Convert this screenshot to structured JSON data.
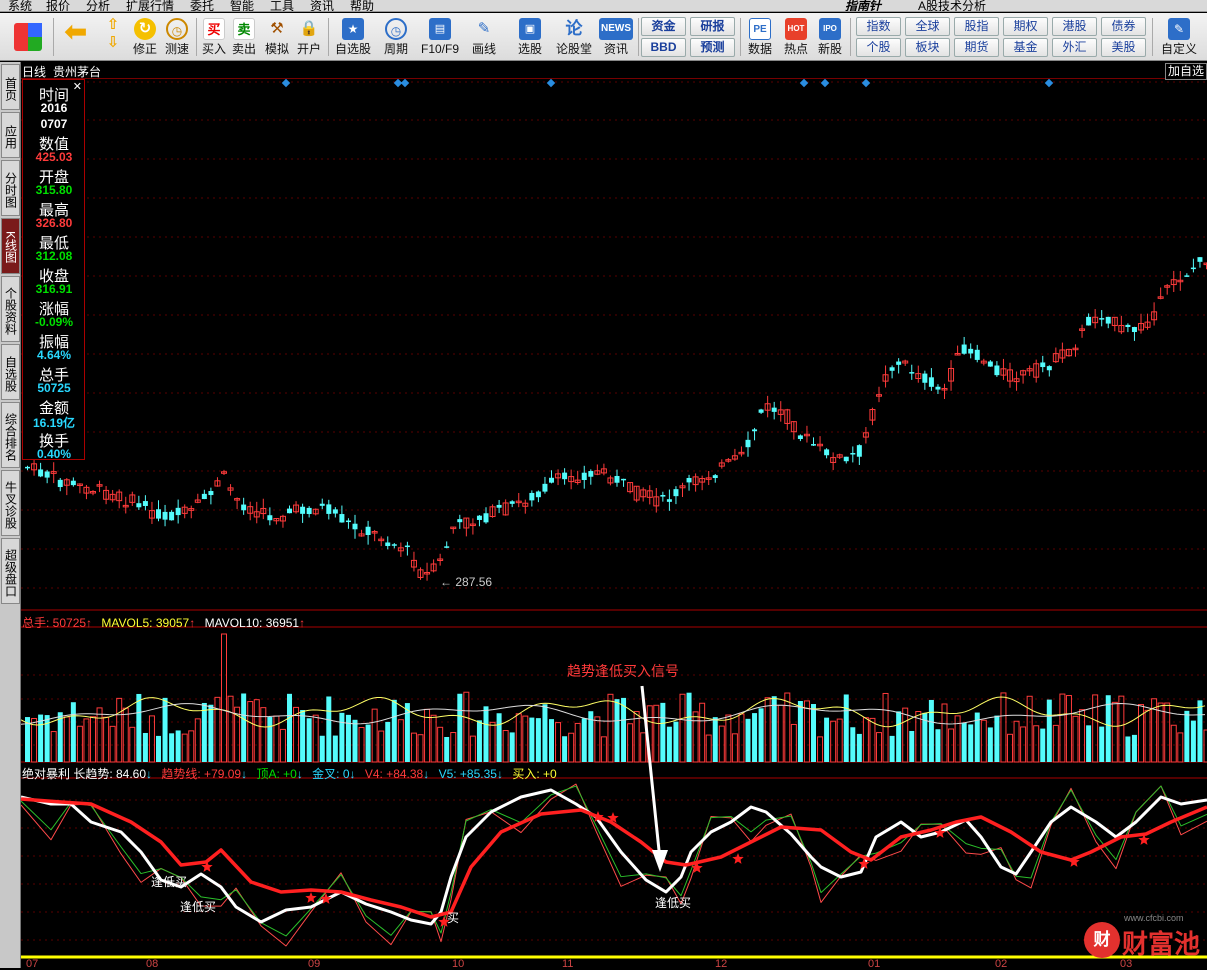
{
  "menu": [
    "系统",
    "报价",
    "分析",
    "扩展行情",
    "委托",
    "智能",
    "工具",
    "资讯",
    "帮助"
  ],
  "brand": "指南针",
  "app_title": "A股技术分析",
  "toolbar": [
    {
      "id": "home",
      "label": ""
    },
    {
      "id": "back",
      "label": ""
    },
    {
      "id": "updown",
      "label": ""
    },
    {
      "id": "fix",
      "label": "修正"
    },
    {
      "id": "speed",
      "label": "测速"
    },
    {
      "id": "buy",
      "label": "买入",
      "glyph": "买"
    },
    {
      "id": "sell",
      "label": "卖出",
      "glyph": "卖"
    },
    {
      "id": "sim",
      "label": "模拟"
    },
    {
      "id": "open",
      "label": "开户"
    },
    {
      "id": "watch",
      "label": "自选股"
    },
    {
      "id": "period",
      "label": "周期"
    },
    {
      "id": "f10",
      "label": "F10/F9"
    },
    {
      "id": "draw",
      "label": "画线"
    },
    {
      "id": "pick",
      "label": "选股"
    },
    {
      "id": "forum",
      "label": "论股堂",
      "glyph": "论"
    },
    {
      "id": "news",
      "label": "资讯",
      "glyph": "NEWS"
    },
    {
      "id": "data",
      "label": "数据",
      "glyph": "PE"
    },
    {
      "id": "hot",
      "label": "热点",
      "glyph": "HOT"
    },
    {
      "id": "newstock",
      "label": "新股",
      "glyph": "IPO"
    },
    {
      "id": "custom",
      "label": "自定义"
    }
  ],
  "grid_buttons": {
    "left": [
      "资金",
      "研报",
      "BBD",
      "预测"
    ],
    "right": [
      "指数",
      "全球",
      "股指",
      "期权",
      "港股",
      "债券",
      "个股",
      "板块",
      "期货",
      "基金",
      "外汇",
      "美股"
    ]
  },
  "sidebar_tabs": [
    "首页",
    "应用",
    "分时图",
    "K线图",
    "个股资料",
    "自选股",
    "综合排名",
    "牛叉诊股",
    "超级盘口"
  ],
  "active_tab": "K线图",
  "chart_title": {
    "period": "日线",
    "stock": "贵州茅台"
  },
  "right_button": "加自选",
  "info_panel": [
    {
      "label": "时间",
      "value": "2016\n0707",
      "color": "#ffffff"
    },
    {
      "label": "数值",
      "value": "425.03",
      "color": "#ff3b3b"
    },
    {
      "label": "开盘",
      "value": "315.80",
      "color": "#00e000"
    },
    {
      "label": "最高",
      "value": "326.80",
      "color": "#ff3b3b"
    },
    {
      "label": "最低",
      "value": "312.08",
      "color": "#00e000"
    },
    {
      "label": "收盘",
      "value": "316.91",
      "color": "#00e000"
    },
    {
      "label": "涨幅",
      "value": "-0.09%",
      "color": "#00e000"
    },
    {
      "label": "振幅",
      "value": "4.64%",
      "color": "#29d8ff"
    },
    {
      "label": "总手",
      "value": "50725",
      "color": "#29d8ff"
    },
    {
      "label": "金额",
      "value": "16.19亿",
      "color": "#29d8ff"
    },
    {
      "label": "换手",
      "value": "0.40%",
      "color": "#29d8ff"
    }
  ],
  "volume_indicator": [
    {
      "text": "总手: 50725",
      "color": "#ff3b3b"
    },
    {
      "text": "MAVOL5: 39057",
      "color": "#ffff33"
    },
    {
      "text": "MAVOL10: 36951",
      "color": "#ffffff"
    }
  ],
  "lower_indicator": [
    {
      "text": "绝对暴利 长趋势: 84.60",
      "color": "#ffffff"
    },
    {
      "text": "趋势线: +79.09",
      "color": "#ff3b3b"
    },
    {
      "text": "顶A: +0",
      "color": "#00e000"
    },
    {
      "text": "金叉: 0",
      "color": "#29d8ff"
    },
    {
      "text": "V4: +84.38",
      "color": "#ff3b3b"
    },
    {
      "text": "V5: +85.35",
      "color": "#29d8ff"
    },
    {
      "text": "买入: +0",
      "color": "#ffff33"
    }
  ],
  "annotation": "趋势逢低买入信号",
  "low_marker": "287.56",
  "signal_labels": [
    "逢低买",
    "逢低买",
    "买",
    "逢低买"
  ],
  "x_axis": [
    "07",
    "08",
    "09",
    "10",
    "11",
    "12",
    "01",
    "02",
    "03"
  ],
  "watermark": {
    "logo": "财",
    "name": "财富池",
    "url": "www.cfcbi.com"
  },
  "chart_data": {
    "type": "candlestick",
    "price": {
      "low_marked": 287.56,
      "last_close": 316.91
    },
    "volume_ma": {
      "mavol5": 39057,
      "mavol10": 36951
    }
  }
}
